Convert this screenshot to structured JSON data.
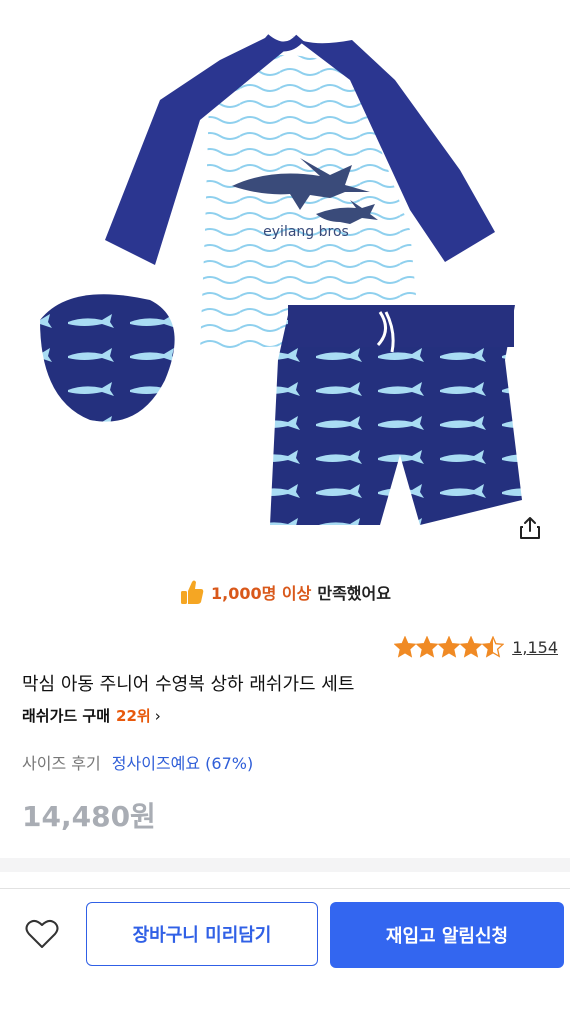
{
  "product": {
    "image_alt": "shark rash guard set",
    "print_text": "eyilang bros",
    "satisfaction_count": "1,000명 이상",
    "satisfaction_rest": "만족했어요",
    "rating_value": 4.5,
    "review_count": "1,154",
    "title": "막심 아동 주니어 수영복 상하 래쉬가드 세트",
    "rank_label": "래쉬가드 구매",
    "rank_value": "22위",
    "rank_chevron": "›",
    "size_review_label": "사이즈 후기",
    "size_review_value": "정사이즈예요 (67%)",
    "price": "14,480원"
  },
  "bottom_bar": {
    "cart_label": "장바구니 미리담기",
    "restock_label": "재입고 알림신청"
  },
  "icons": {
    "share": "share-icon",
    "heart": "heart-icon",
    "thumb": "thumbs-up-icon",
    "star": "star-icon"
  },
  "colors": {
    "accent_blue": "#3366f0",
    "rank_orange": "#e8590c",
    "star_orange": "#f08a24",
    "size_blue": "#2f5ed8",
    "navy": "#1f2a7a"
  }
}
